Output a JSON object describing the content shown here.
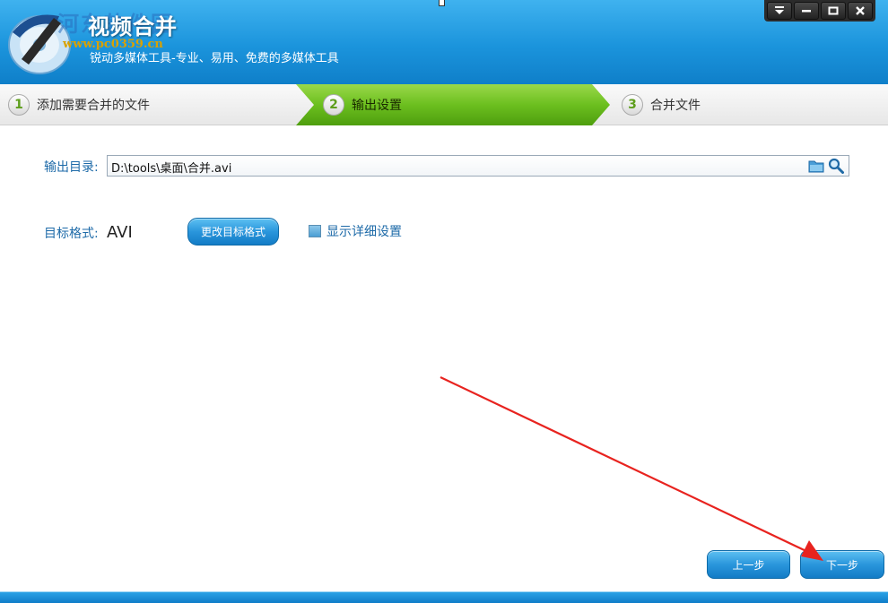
{
  "window": {
    "title": "视频合并",
    "subtitle": "锐动多媒体工具-专业、易用、免费的多媒体工具",
    "watermark_cn": "河东软件园",
    "watermark_url": "www.pc0359.cn",
    "controls": [
      "menu-icon",
      "minimize-icon",
      "maximize-icon",
      "close-icon"
    ]
  },
  "steps": [
    {
      "num": "1",
      "label": "添加需要合并的文件"
    },
    {
      "num": "2",
      "label": "输出设置"
    },
    {
      "num": "3",
      "label": "合并文件"
    }
  ],
  "active_step": "2",
  "output": {
    "label": "输出目录:",
    "value": "D:\\tools\\桌面\\合并.avi"
  },
  "format": {
    "label": "目标格式:",
    "value": "AVI",
    "change_button": "更改目标格式"
  },
  "details_checkbox": {
    "label": "显示详细设置",
    "checked": false
  },
  "nav": {
    "prev": "上一步",
    "next": "下一步"
  },
  "colors": {
    "header": "#1b94dc",
    "active_step": "#5fb41a",
    "accent_text": "#1d6aa8",
    "annotation_arrow": "#e8231f"
  }
}
